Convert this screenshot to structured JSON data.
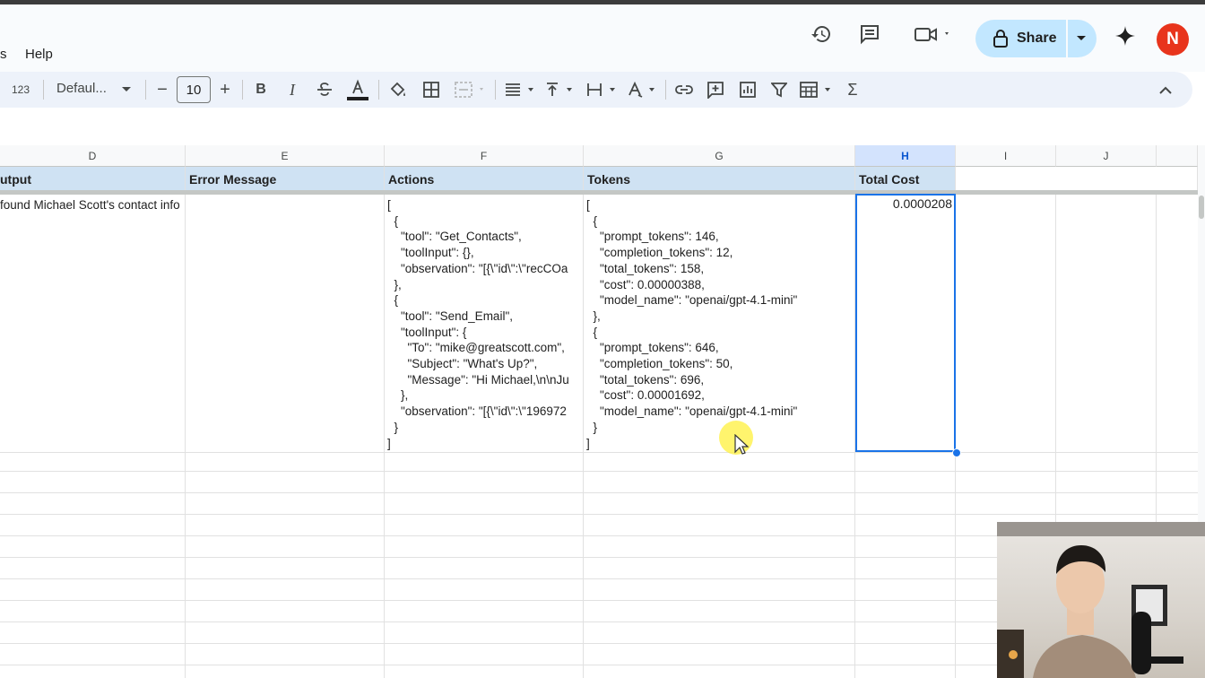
{
  "menu": {
    "partial": "s",
    "help": "Help"
  },
  "header": {
    "share_label": "Share",
    "avatar_initial": "N"
  },
  "toolbar": {
    "format_123": "123",
    "font": "Defaul...",
    "font_size": "10",
    "minus": "−",
    "plus": "+",
    "bold": "B",
    "italic": "I",
    "sigma": "Σ"
  },
  "columns": [
    "D",
    "E",
    "F",
    "G",
    "H",
    "I",
    "J"
  ],
  "headers": {
    "d": "utput",
    "e": "Error Message",
    "f": "Actions",
    "g": "Tokens",
    "h": "Total Cost"
  },
  "row": {
    "output": "found Michael Scott's contact info",
    "actions": "[\n  {\n    \"tool\": \"Get_Contacts\",\n    \"toolInput\": {},\n    \"observation\": \"[{\\\"id\\\":\\\"recCOa\n  },\n  {\n    \"tool\": \"Send_Email\",\n    \"toolInput\": {\n      \"To\": \"mike@greatscott.com\",\n      \"Subject\": \"What's Up?\",\n      \"Message\": \"Hi Michael,\\n\\nJu\n    },\n    \"observation\": \"[{\\\"id\\\":\\\"196972\n  }\n]",
    "tokens": "[\n  {\n    \"prompt_tokens\": 146,\n    \"completion_tokens\": 12,\n    \"total_tokens\": 158,\n    \"cost\": 0.00000388,\n    \"model_name\": \"openai/gpt-4.1-mini\"\n  },\n  {\n    \"prompt_tokens\": 646,\n    \"completion_tokens\": 50,\n    \"total_tokens\": 696,\n    \"cost\": 0.00001692,\n    \"model_name\": \"openai/gpt-4.1-mini\"\n  }\n]",
    "total_cost": "0.0000208"
  },
  "colors": {
    "accent": "#1a73e8",
    "header_fill": "#cfe2f3",
    "share_bg": "#c2e7ff",
    "avatar_bg": "#e8341c"
  },
  "icons": [
    "history-icon",
    "comment-icon",
    "video-icon",
    "lock-icon",
    "sparkle-icon",
    "paint-bucket-icon",
    "borders-icon",
    "merge-icon",
    "align-icon",
    "valign-icon",
    "wrap-icon",
    "rotate-icon",
    "link-icon",
    "insert-comment-icon",
    "chart-icon",
    "filter-icon",
    "table-icon",
    "sigma-icon",
    "collapse-icon"
  ]
}
